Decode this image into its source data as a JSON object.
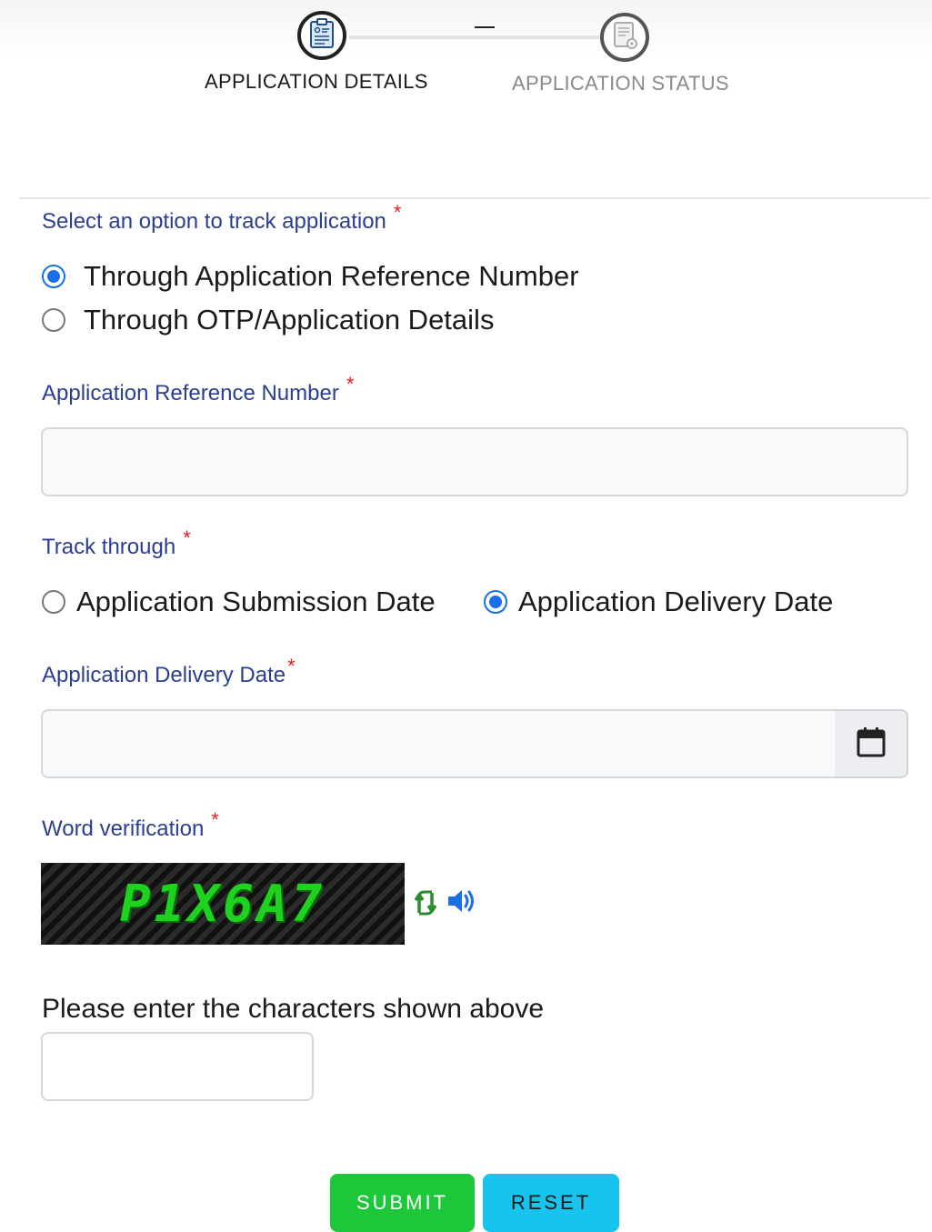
{
  "stepper": {
    "steps": [
      {
        "label": "APPLICATION DETAILS",
        "state": "active",
        "icon": "clipboard-form-icon"
      },
      {
        "label": "APPLICATION STATUS",
        "state": "inactive",
        "icon": "document-gear-icon"
      }
    ]
  },
  "track_option": {
    "label": "Select an option to track application",
    "required_mark": "*",
    "options": [
      {
        "label": "Through Application Reference Number",
        "selected": true
      },
      {
        "label": "Through OTP/Application Details",
        "selected": false
      }
    ]
  },
  "reference_number": {
    "label": "Application Reference Number",
    "required_mark": "*",
    "value": "",
    "placeholder": ""
  },
  "track_through": {
    "label": "Track through",
    "required_mark": "*",
    "options": [
      {
        "label": "Application Submission Date",
        "selected": false
      },
      {
        "label": "Application Delivery Date",
        "selected": true
      }
    ]
  },
  "delivery_date": {
    "label": "Application Delivery Date",
    "required_mark": "*",
    "value": "",
    "placeholder": "",
    "icon": "calendar-icon"
  },
  "word_verification": {
    "label": "Word verification",
    "required_mark": "*",
    "captcha_text": "P1X6A7",
    "refresh_icon": "refresh-icon",
    "audio_icon": "speaker-icon"
  },
  "captcha_entry": {
    "label": "Please enter the characters shown above",
    "value": "",
    "placeholder": ""
  },
  "actions": {
    "submit_label": "SUBMIT",
    "reset_label": "RESET"
  },
  "colors": {
    "label_blue": "#2b3e91",
    "required_red": "#e02020",
    "radio_blue": "#1a6fe8",
    "submit_green": "#1cc83a",
    "reset_cyan": "#17c4ee",
    "captcha_green": "#1fd21f"
  }
}
